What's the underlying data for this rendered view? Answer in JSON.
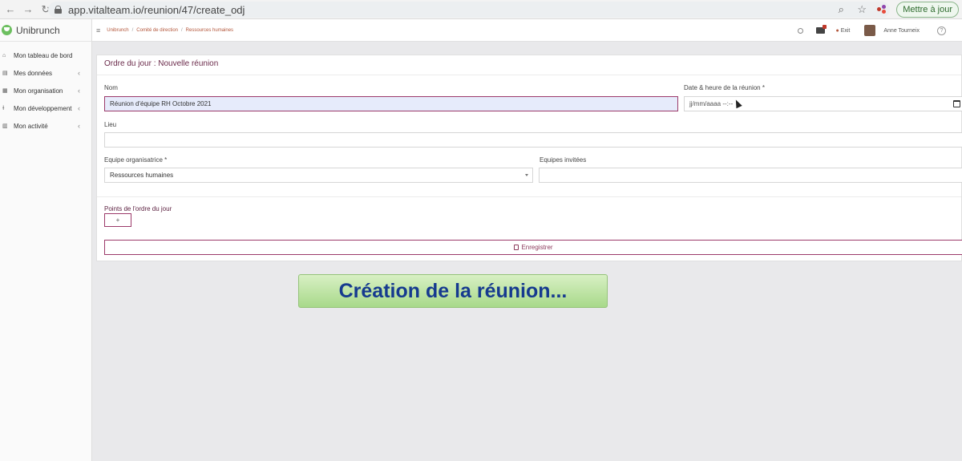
{
  "browser": {
    "url": "app.vitalteam.io/reunion/47/create_odj",
    "update_label": "Mettre à jour"
  },
  "sidebar": {
    "brand": "Unibrunch",
    "items": [
      {
        "label": "Mon tableau de bord",
        "icon": "home-icon"
      },
      {
        "label": "Mes données",
        "icon": "database-icon"
      },
      {
        "label": "Mon organisation",
        "icon": "building-icon"
      },
      {
        "label": "Mon développement",
        "icon": "chart-icon"
      },
      {
        "label": "Mon activité",
        "icon": "activity-icon"
      }
    ]
  },
  "topbar": {
    "breadcrumb": [
      "Unibrunch",
      "Comité de direction",
      "Ressources humaines"
    ],
    "exit_label": "Exit",
    "user_name": "Anne Tourneix",
    "help_label": "?"
  },
  "form": {
    "title": "Ordre du jour : Nouvelle réunion",
    "name_label": "Nom",
    "name_value": "Réunion d'équipe RH Octobre 2021",
    "datetime_label": "Date & heure de la réunion *",
    "datetime_placeholder": "jj/mm/aaaa --:--",
    "location_label": "Lieu",
    "location_value": "",
    "org_team_label": "Equipe organisatrice *",
    "org_team_value": "Ressources humaines",
    "invited_label": "Equipes invitées",
    "invited_value": "",
    "points_label": "Points de l'ordre du jour",
    "add_label": "+",
    "save_label": "Enregistrer"
  },
  "overlay": {
    "caption": "Création de la réunion..."
  }
}
